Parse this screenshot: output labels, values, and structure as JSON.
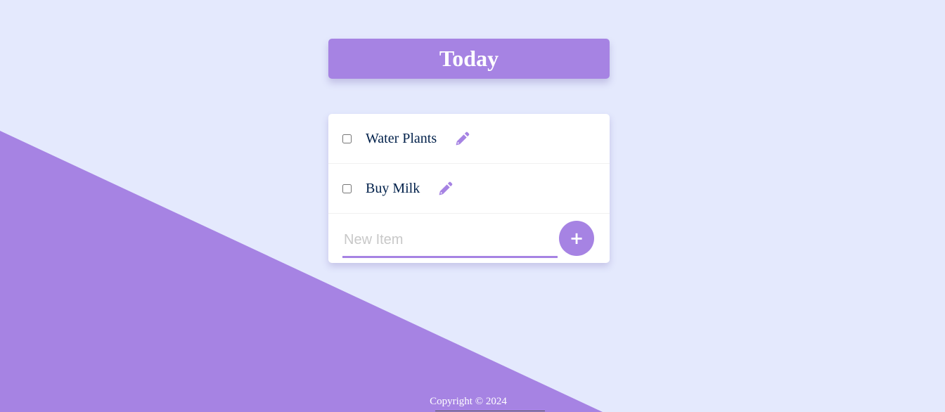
{
  "colors": {
    "background": "#E4E9FD",
    "accent": "#A683E3",
    "card": "#FFFFFF",
    "text": "#00204A"
  },
  "header": {
    "title": "Today"
  },
  "list": {
    "items": [
      {
        "label": "Water Plants",
        "checked": false,
        "icon": "pencil-icon"
      },
      {
        "label": "Buy Milk",
        "checked": false,
        "icon": "pencil-icon"
      }
    ],
    "new_item": {
      "placeholder": "New Item",
      "value": ""
    },
    "add_button_label": "+"
  },
  "footer": {
    "copyright": "Copyright © 2024"
  }
}
